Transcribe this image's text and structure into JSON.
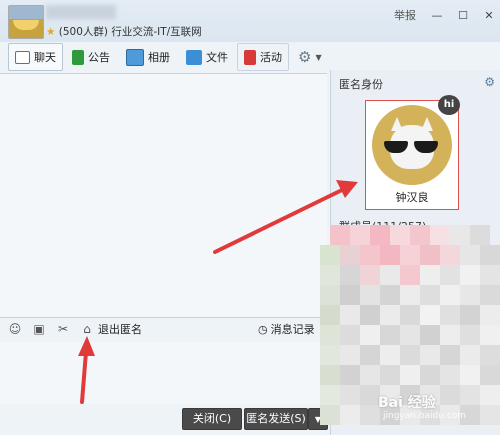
{
  "window": {
    "group_subtitle": "(500人群) 行业交流-IT/互联网",
    "report_label": "举报",
    "minimize_symbol": "—",
    "maximize_symbol": "☐",
    "close_symbol": "✕"
  },
  "tabs": [
    {
      "label": "聊天",
      "icon": "chat-icon",
      "active": true
    },
    {
      "label": "公告",
      "icon": "announcement-flag-icon"
    },
    {
      "label": "相册",
      "icon": "photo-album-icon"
    },
    {
      "label": "文件",
      "icon": "folder-icon"
    },
    {
      "label": "活动",
      "icon": "activity-flag-icon"
    }
  ],
  "toolbar": {
    "exit_anonymous": "退出匿名",
    "message_record": "消息记录"
  },
  "bottom": {
    "close_button": "关闭(C)",
    "send_button": "匿名发送(S)"
  },
  "right_panel": {
    "anon_title": "匿名身份",
    "anon_name": "钟汉良",
    "hi_badge": "hi",
    "members_title": "群成员(111/257)"
  },
  "watermark": {
    "text": "Bai 经验",
    "sub": "jingyan.baidu.com"
  },
  "colors": {
    "accent_red": "#e03a3a",
    "window_bg": "#eef3f8",
    "button_dark": "#4a4a4a"
  }
}
